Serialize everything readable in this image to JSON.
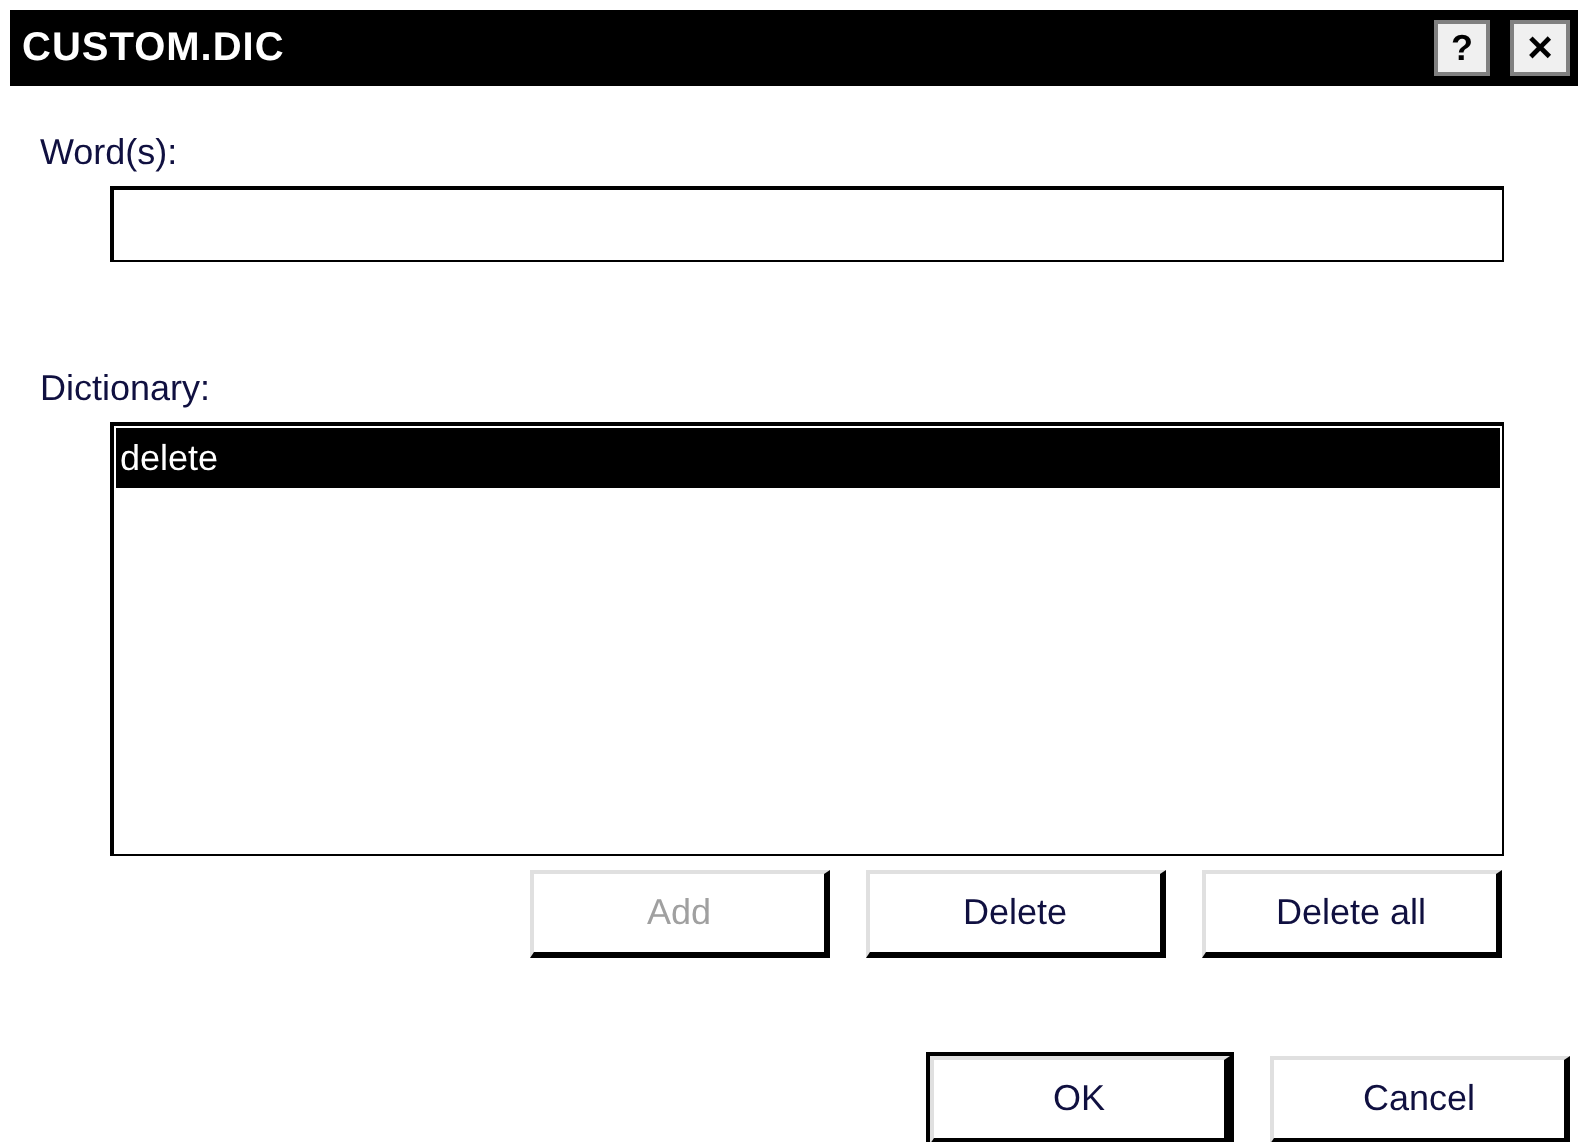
{
  "window": {
    "title": "CUSTOM.DIC",
    "help_button": "?",
    "close_button": "×"
  },
  "word_field": {
    "label": "Word(s):"
  },
  "dictionary": {
    "label": "Dictionary:",
    "items": [
      {
        "text": "delete",
        "selected": true
      }
    ]
  },
  "list_buttons": [
    {
      "label": "Add",
      "disabled": true
    },
    {
      "label": "Delete",
      "disabled": false
    },
    {
      "label": "Delete all",
      "disabled": false
    }
  ],
  "dialog_buttons": [
    {
      "label": "OK",
      "default": true
    },
    {
      "label": "Cancel",
      "default": false
    }
  ]
}
